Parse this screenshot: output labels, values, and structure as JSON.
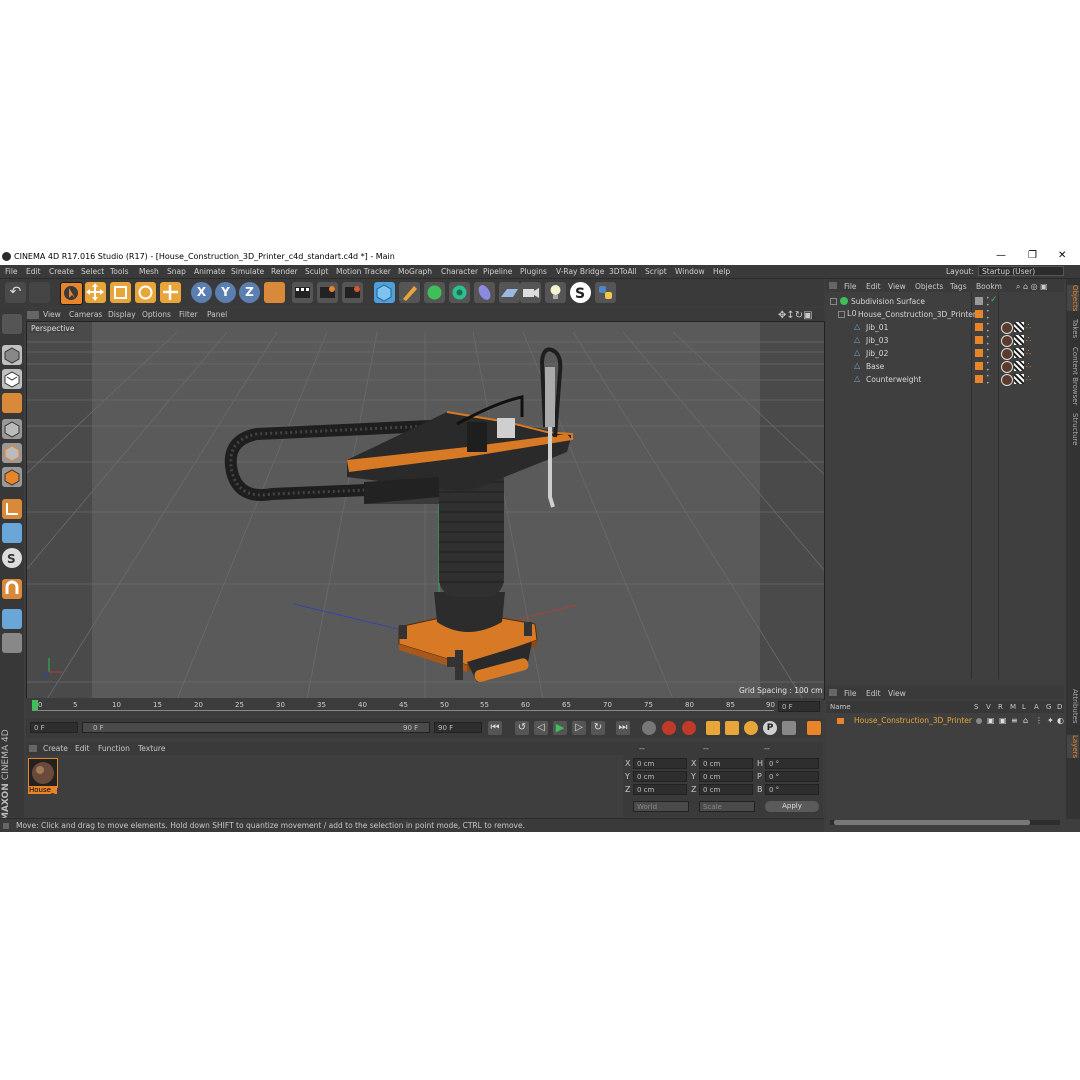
{
  "window": {
    "title": "CINEMA 4D R17.016 Studio (R17) - [House_Construction_3D_Printer_c4d_standart.c4d *] - Main",
    "controls": [
      "—",
      "❐",
      "✕"
    ]
  },
  "menubar": {
    "items": [
      "File",
      "Edit",
      "Create",
      "Select",
      "Tools",
      "Mesh",
      "Snap",
      "Animate",
      "Simulate",
      "Render",
      "Sculpt",
      "Motion Tracker",
      "MoGraph",
      "Character",
      "Pipeline",
      "Plugins",
      "V-Ray Bridge",
      "3DToAll",
      "Script",
      "Window",
      "Help"
    ],
    "layout_label": "Layout:",
    "layout_value": "Startup (User)"
  },
  "toolbar": {
    "axis_x": "X",
    "axis_y": "Y",
    "axis_z": "Z"
  },
  "viewport": {
    "menu": [
      "View",
      "Cameras",
      "Display",
      "Options",
      "Filter",
      "Panel"
    ],
    "label": "Perspective",
    "grid_spacing": "Grid Spacing : 100 cm"
  },
  "timeline": {
    "ticks": [
      "0",
      "5",
      "10",
      "15",
      "20",
      "25",
      "30",
      "35",
      "40",
      "45",
      "50",
      "55",
      "60",
      "65",
      "70",
      "75",
      "80",
      "85",
      "90"
    ],
    "current_frame": "0 F"
  },
  "playback": {
    "start": "0 F",
    "range_start": "0 F",
    "range_end": "90 F",
    "end": "90 F"
  },
  "material_manager": {
    "menu": [
      "Create",
      "Edit",
      "Function",
      "Texture"
    ],
    "material_name": "House_"
  },
  "coords": {
    "headers": [
      "--",
      "--",
      "--"
    ],
    "rows": [
      {
        "a": "X",
        "av": "0 cm",
        "b": "X",
        "bv": "0 cm",
        "c": "H",
        "cv": "0 °"
      },
      {
        "a": "Y",
        "av": "0 cm",
        "b": "Y",
        "bv": "0 cm",
        "c": "P",
        "cv": "0 °"
      },
      {
        "a": "Z",
        "av": "0 cm",
        "b": "Z",
        "bv": "0 cm",
        "c": "B",
        "cv": "0 °"
      }
    ],
    "space": "World",
    "mode": "Scale",
    "apply": "Apply"
  },
  "status": {
    "text": "Move: Click and drag to move elements. Hold down SHIFT to quantize movement / add to the selection in point mode, CTRL to remove."
  },
  "object_manager": {
    "menu": [
      "File",
      "Edit",
      "View",
      "Objects",
      "Tags",
      "Bookm"
    ],
    "objects": [
      {
        "name": "Subdivision Surface",
        "indent": 0
      },
      {
        "name": "House_Construction_3D_Printer",
        "indent": 1
      },
      {
        "name": "Jib_01",
        "indent": 2
      },
      {
        "name": "Jib_03",
        "indent": 2
      },
      {
        "name": "Jib_02",
        "indent": 2
      },
      {
        "name": "Base",
        "indent": 2
      },
      {
        "name": "Counterweight",
        "indent": 2
      }
    ]
  },
  "layer_manager": {
    "menu": [
      "File",
      "Edit",
      "View"
    ],
    "headers": [
      "Name",
      "S",
      "V",
      "R",
      "M",
      "L",
      "A",
      "G",
      "D"
    ],
    "layer_name": "House_Construction_3D_Printer"
  },
  "side_tabs": [
    "Objects",
    "Takes",
    "Content Browser",
    "Structure",
    "Attributes",
    "Layers"
  ],
  "brand": {
    "logo_line1": "MAXON",
    "logo_line2": "CINEMA 4D"
  },
  "colors": {
    "accent": "#e8842a",
    "panel": "#3e3e3e",
    "viewport_bg": "#555555",
    "active_blue": "#6aa7d8"
  }
}
